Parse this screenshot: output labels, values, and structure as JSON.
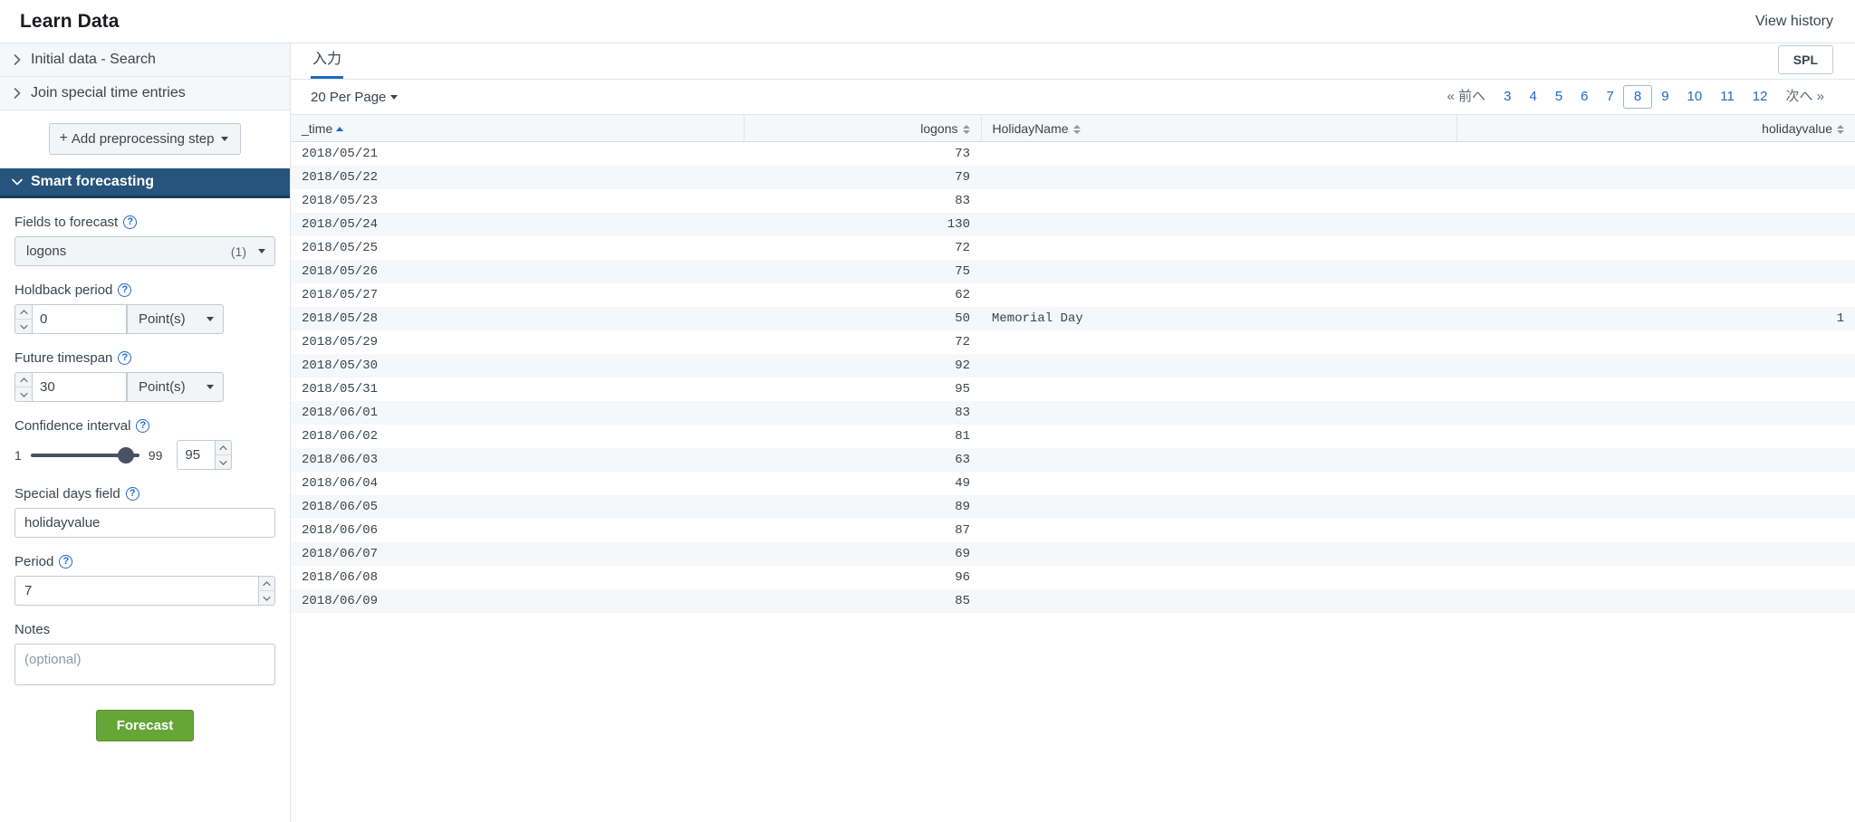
{
  "header": {
    "title": "Learn Data",
    "view_history": "View history"
  },
  "sidebar": {
    "steps": [
      {
        "label": "Initial data - Search",
        "icon": "chevron-right-icon"
      },
      {
        "label": "Join special time entries",
        "icon": "chevron-right-icon"
      }
    ],
    "add_step_button": "Add preprocessing step",
    "add_step_plus": "+",
    "section": {
      "title": "Smart forecasting",
      "icon": "chevron-down-icon"
    },
    "fields": {
      "fields_to_forecast": {
        "label": "Fields to forecast",
        "value": "logons",
        "count": "(1)",
        "help": "?"
      },
      "holdback_period": {
        "label": "Holdback period",
        "value": "0",
        "unit": "Point(s)",
        "help": "?"
      },
      "future_timespan": {
        "label": "Future timespan",
        "value": "30",
        "unit": "Point(s)",
        "help": "?"
      },
      "confidence_interval": {
        "label": "Confidence interval",
        "min": "1",
        "max": "99",
        "value": "95",
        "help": "?"
      },
      "special_days_field": {
        "label": "Special days field",
        "value": "holidayvalue",
        "help": "?"
      },
      "period": {
        "label": "Period",
        "value": "7",
        "help": "?"
      },
      "notes": {
        "label": "Notes",
        "placeholder": "(optional)",
        "value": ""
      }
    },
    "forecast_button": "Forecast"
  },
  "main": {
    "tab": "入力",
    "spl_button": "SPL",
    "per_page": "20 Per Page",
    "pagination": {
      "prev": "« 前へ",
      "next": "次へ »",
      "pages": [
        "3",
        "4",
        "5",
        "6",
        "7",
        "8",
        "9",
        "10",
        "11",
        "12"
      ],
      "active": "8"
    },
    "table": {
      "columns": [
        {
          "label": "_time",
          "sort": "asc",
          "align": "left"
        },
        {
          "label": "logons",
          "sort": "none",
          "align": "right"
        },
        {
          "label": "HolidayName",
          "sort": "none",
          "align": "left"
        },
        {
          "label": "holidayvalue",
          "sort": "none",
          "align": "right"
        }
      ],
      "rows": [
        [
          "2018/05/21",
          "73",
          "",
          ""
        ],
        [
          "2018/05/22",
          "79",
          "",
          ""
        ],
        [
          "2018/05/23",
          "83",
          "",
          ""
        ],
        [
          "2018/05/24",
          "130",
          "",
          ""
        ],
        [
          "2018/05/25",
          "72",
          "",
          ""
        ],
        [
          "2018/05/26",
          "75",
          "",
          ""
        ],
        [
          "2018/05/27",
          "62",
          "",
          ""
        ],
        [
          "2018/05/28",
          "50",
          "Memorial Day",
          "1"
        ],
        [
          "2018/05/29",
          "72",
          "",
          ""
        ],
        [
          "2018/05/30",
          "92",
          "",
          ""
        ],
        [
          "2018/05/31",
          "95",
          "",
          ""
        ],
        [
          "2018/06/01",
          "83",
          "",
          ""
        ],
        [
          "2018/06/02",
          "81",
          "",
          ""
        ],
        [
          "2018/06/03",
          "63",
          "",
          ""
        ],
        [
          "2018/06/04",
          "49",
          "",
          ""
        ],
        [
          "2018/06/05",
          "89",
          "",
          ""
        ],
        [
          "2018/06/06",
          "87",
          "",
          ""
        ],
        [
          "2018/06/07",
          "69",
          "",
          ""
        ],
        [
          "2018/06/08",
          "96",
          "",
          ""
        ],
        [
          "2018/06/09",
          "85",
          "",
          ""
        ]
      ]
    }
  },
  "colors": {
    "accent_blue": "#1e69c7",
    "section_header": "#26547c",
    "forecast_green": "#65a637"
  }
}
